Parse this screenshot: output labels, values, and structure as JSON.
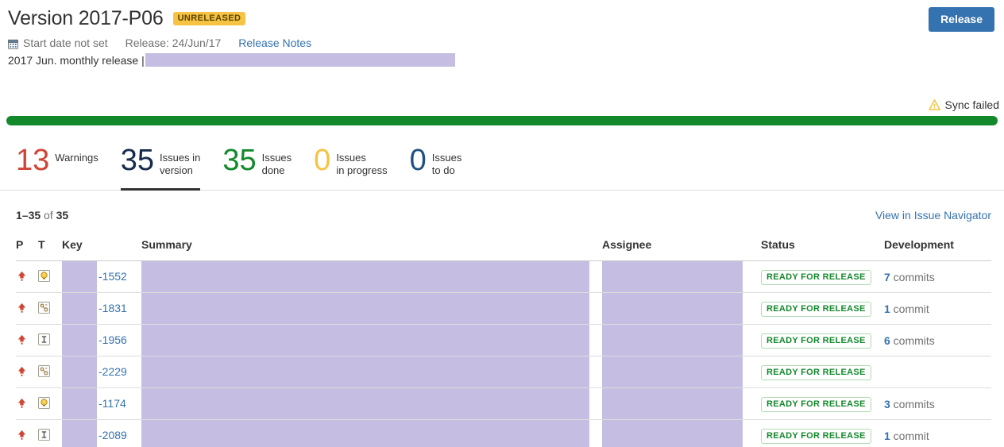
{
  "header": {
    "version_title": "Version 2017-P06",
    "status_badge": "UNRELEASED",
    "start_date": "Start date not set",
    "release_date": "Release: 24/Jun/17",
    "release_notes_link": "Release Notes",
    "description_prefix": "2017 Jun. monthly release |",
    "release_button": "Release",
    "calendar_icon": "calendar-icon"
  },
  "sync": {
    "label": "Sync failed",
    "icon": "warning-triangle-icon",
    "icon_color": "#f6c342"
  },
  "progress": {
    "percent": 100,
    "color": "#14892c"
  },
  "stats": [
    {
      "num": "13",
      "label_line1": "Warnings",
      "label_line2": "",
      "color": "#d04437",
      "active": false,
      "name": "warnings"
    },
    {
      "num": "35",
      "label_line1": "Issues in",
      "label_line2": "version",
      "color": "#172b4d",
      "active": true,
      "name": "issues-in-version"
    },
    {
      "num": "35",
      "label_line1": "Issues",
      "label_line2": "done",
      "color": "#14892c",
      "active": false,
      "name": "issues-done"
    },
    {
      "num": "0",
      "label_line1": "Issues",
      "label_line2": "in progress",
      "color": "#f6c342",
      "active": false,
      "name": "issues-in-progress"
    },
    {
      "num": "0",
      "label_line1": "Issues",
      "label_line2": "to do",
      "color": "#205081",
      "active": false,
      "name": "issues-to-do"
    }
  ],
  "list": {
    "range_start": "1–35",
    "range_of": " of ",
    "range_total": "35",
    "navigator_link": "View in Issue Navigator",
    "columns": {
      "p": "P",
      "t": "T",
      "key": "Key",
      "summary": "Summary",
      "assignee": "Assignee",
      "status": "Status",
      "development": "Development"
    }
  },
  "rows": [
    {
      "priority": "major-up-arrow-icon",
      "type": "improvement-lightbulb-icon",
      "key_suffix": "-1552",
      "status": "READY FOR RELEASE",
      "dev_count": "7",
      "dev_label": " commits"
    },
    {
      "priority": "major-up-arrow-icon",
      "type": "story-icon",
      "key_suffix": "-1831",
      "status": "READY FOR RELEASE",
      "dev_count": "1",
      "dev_label": " commit"
    },
    {
      "priority": "major-up-arrow-icon",
      "type": "task-icon",
      "key_suffix": "-1956",
      "status": "READY FOR RELEASE",
      "dev_count": "6",
      "dev_label": " commits"
    },
    {
      "priority": "major-up-arrow-icon",
      "type": "story-icon",
      "key_suffix": "-2229",
      "status": "READY FOR RELEASE",
      "dev_count": "",
      "dev_label": ""
    },
    {
      "priority": "major-up-arrow-icon",
      "type": "improvement-lightbulb-icon",
      "key_suffix": "-1174",
      "status": "READY FOR RELEASE",
      "dev_count": "3",
      "dev_label": " commits"
    },
    {
      "priority": "major-up-arrow-icon",
      "type": "task-icon",
      "key_suffix": "-2089",
      "status": "READY FOR RELEASE",
      "dev_count": "1",
      "dev_label": " commit"
    }
  ],
  "colors": {
    "redaction": "#c5bee2",
    "link": "#3572b0",
    "green": "#14892c",
    "amber": "#f6c342",
    "red": "#d04437"
  }
}
